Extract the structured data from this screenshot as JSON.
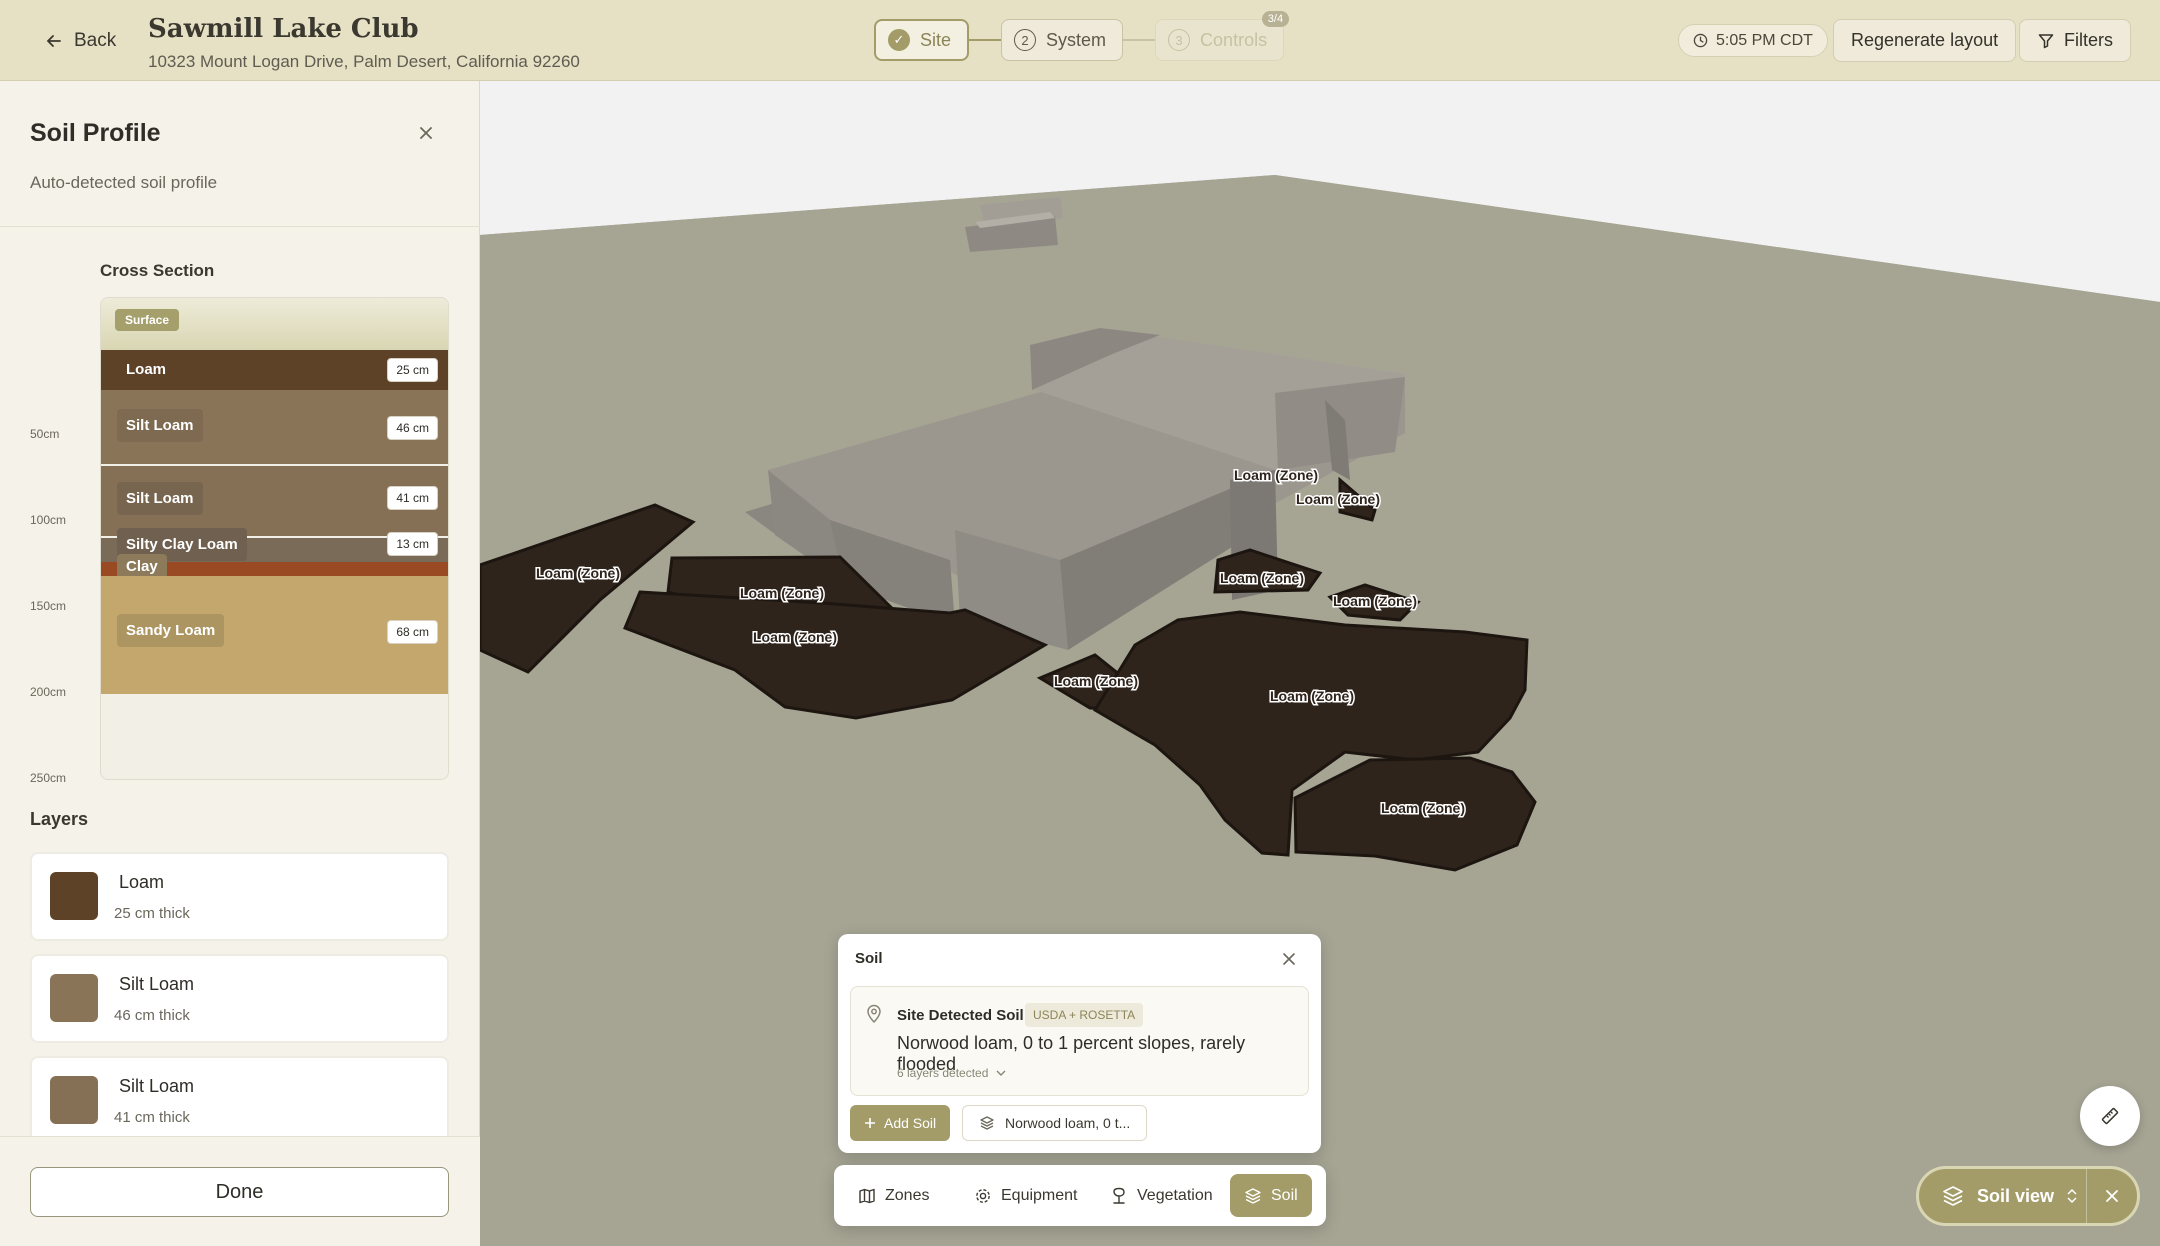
{
  "header": {
    "back_label": "Back",
    "title": "Sawmill Lake Club",
    "address": "10323 Mount Logan Drive, Palm Desert, California 92260",
    "steps": [
      {
        "num": "✓",
        "label": "Site"
      },
      {
        "num": "2",
        "label": "System"
      },
      {
        "num": "3",
        "label": "Controls",
        "badge": "3/4"
      }
    ],
    "time": "5:05 PM CDT",
    "regenerate_label": "Regenerate layout",
    "filters_label": "Filters"
  },
  "panel": {
    "title": "Soil Profile",
    "subtitle": "Auto-detected soil profile",
    "cross_section_title": "Cross Section",
    "surface_label": "Surface",
    "depth_labels": [
      "50cm",
      "100cm",
      "150cm",
      "200cm",
      "250cm"
    ],
    "cross_section_layers": [
      {
        "name": "Loam",
        "thickness": "25 cm",
        "color": "#5d4228"
      },
      {
        "name": "Silt Loam",
        "thickness": "46 cm",
        "color": "#8a7457"
      },
      {
        "name": "Silt Loam",
        "thickness": "41 cm",
        "color": "#857055"
      },
      {
        "name": "Silty Clay Loam",
        "thickness": "13 cm",
        "color": "#7a6a58"
      },
      {
        "name": "Clay",
        "thickness": "",
        "color": "#9a4a22"
      },
      {
        "name": "Sandy Loam",
        "thickness": "68 cm",
        "color": "#c3a76c"
      }
    ],
    "layers_title": "Layers",
    "layer_cards": [
      {
        "name": "Loam",
        "sub": "25 cm thick",
        "color": "#5d4228"
      },
      {
        "name": "Silt Loam",
        "sub": "46 cm thick",
        "color": "#8a7457"
      },
      {
        "name": "Silt Loam",
        "sub": "41 cm thick",
        "color": "#857055"
      }
    ],
    "done_label": "Done"
  },
  "map": {
    "zone_labels": [
      "Loam (Zone)",
      "Loam (Zone)",
      "Loam (Zone)",
      "Loam (Zone)",
      "Loam (Zone)",
      "Loam (Zone)",
      "Loam (Zone)",
      "Loam (Zone)",
      "Loam (Zone)",
      "Loam (Zone)",
      "Loam (Zone)"
    ]
  },
  "soil_card": {
    "title": "Soil",
    "detected_title": "Site Detected Soil",
    "source_badge": "USDA + ROSETTA",
    "soil_name": "Norwood loam, 0 to 1 percent slopes, rarely flooded",
    "layers_detected": "6 layers detected",
    "add_soil_label": "Add Soil",
    "chip_label": "Norwood loam, 0 t..."
  },
  "toolbar": {
    "zones": "Zones",
    "equipment": "Equipment",
    "vegetation": "Vegetation",
    "soil": "Soil"
  },
  "soil_view_label": "Soil view",
  "colors": {
    "accent": "#a39c69",
    "zone_fill": "#2f241c",
    "ground": "#a6a594",
    "building": "#8f8b84"
  }
}
